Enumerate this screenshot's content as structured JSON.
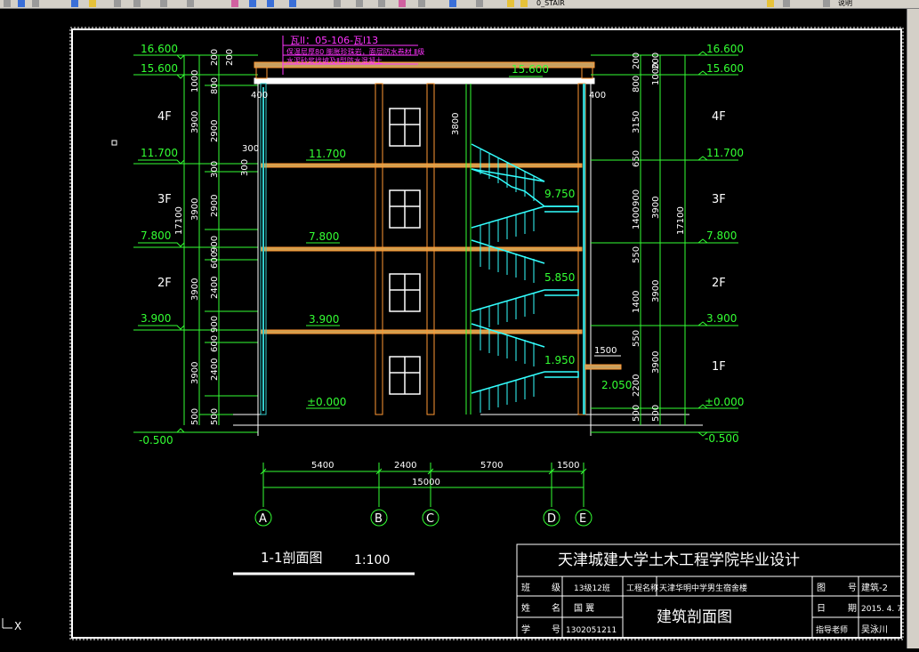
{
  "toolbar": {
    "layer_name": "0_STAIR",
    "text_style": "说明"
  },
  "section": {
    "note_ref": "瓦ll：05-106-瓦l13",
    "note_lines": [
      "保温层厚80 膨胀珍珠岩，面层防水卷材  Ⅱ级",
      "水泥砂浆找坡及Ⅱ型防水混凝土"
    ],
    "roof_level": "15.600",
    "floor_levels_center": [
      "11.700",
      "7.800",
      "3.900",
      "±0.000"
    ],
    "landing_levels": [
      "9.750",
      "5.850",
      "1.950",
      "2.050"
    ],
    "stair_height_label": "3800",
    "canopy_width": "1500",
    "parapet_thickness_left": "400",
    "parapet_thickness_right": "400",
    "small_dims": [
      "300",
      "300"
    ]
  },
  "left_dims": {
    "levels": [
      "16.600",
      "15.600",
      "11.700",
      "7.800",
      "3.900",
      "-0.500"
    ],
    "floors": [
      "4F",
      "3F",
      "2F"
    ],
    "outer": [
      "1000",
      "3900",
      "3900",
      "3900",
      "3900",
      "500"
    ],
    "total": "17100",
    "inner": [
      "200",
      "200",
      "800",
      "2900",
      "300",
      "2900",
      "900",
      "600",
      "2400",
      "900",
      "600",
      "2400",
      "500"
    ]
  },
  "right_dims": {
    "levels": [
      "16.600",
      "15.600",
      "11.700",
      "7.800",
      "3.900",
      "±0.000",
      "-0.500"
    ],
    "floors": [
      "4F",
      "3F",
      "2F",
      "1F"
    ],
    "outer": [
      "200",
      "1000",
      "3150",
      "650",
      "900",
      "3900",
      "3900",
      "3900",
      "500"
    ],
    "total": "17100",
    "inner": [
      "200",
      "800",
      "550",
      "1400",
      "550",
      "550",
      "1400",
      "550",
      "550",
      "1400",
      "50",
      "2200",
      "300",
      "900",
      "300",
      "500"
    ]
  },
  "bottom_dims": {
    "spans": [
      "5400",
      "2400",
      "5700",
      "1500"
    ],
    "total": "15000",
    "axes": [
      "A",
      "B",
      "C",
      "D",
      "E"
    ]
  },
  "drawing_title": {
    "name": "1-1剖面图",
    "scale": "1:100"
  },
  "title_block": {
    "school": "天津城建大学土木工程学院毕业设计",
    "class_label": "班",
    "class_label2": "级",
    "class_value": "13级12班",
    "project_label": "工程名称",
    "project_value": "天津华明中学男生宿舍楼",
    "drawing_no_label": "图",
    "drawing_no_label2": "号",
    "drawing_no_value": "建筑-2",
    "name_label": "姓",
    "name_label2": "名",
    "name_value": "国  翼",
    "drawing_name": "建筑剖面图",
    "date_label": "日",
    "date_label2": "期",
    "date_value": "2015. 4. 7",
    "id_label": "学",
    "id_label2": "号",
    "id_value": "1302051211",
    "advisor_label": "指导老师",
    "advisor_value": "吴泳川"
  },
  "ucs_label": "X"
}
